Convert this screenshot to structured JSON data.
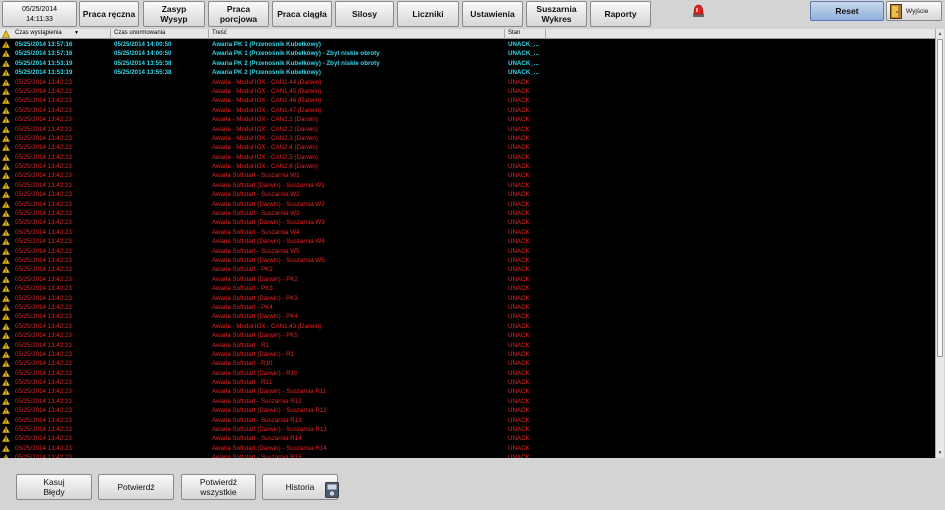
{
  "header": {
    "date": "05/25/2014",
    "time": "14:11:33",
    "nav": [
      {
        "label": "Praca ręczna",
        "name": "nav-praca-reczna"
      },
      {
        "label": "Zasyp\nWysyp",
        "name": "nav-zasyp-wysyp"
      },
      {
        "label": "Praca\nporcjowa",
        "name": "nav-praca-porcjowa"
      },
      {
        "label": "Praca ciągła",
        "name": "nav-praca-ciagla"
      },
      {
        "label": "Silosy",
        "name": "nav-silosy"
      },
      {
        "label": "Liczniki",
        "name": "nav-liczniki"
      },
      {
        "label": "Ustawienia",
        "name": "nav-ustawienia"
      },
      {
        "label": "Suszarnia\nWykres",
        "name": "nav-suszarnia-wykres"
      },
      {
        "label": "Raporty",
        "name": "nav-raporty"
      }
    ],
    "reset_label": "Reset",
    "exit_label": "Wyjście"
  },
  "alarms": {
    "columns": [
      "Czas wystąpienia",
      "Czas unormowania",
      "Treść",
      "Stan"
    ],
    "rows": [
      {
        "t1": "05/25/2014 13:57:16",
        "t2": "05/25/2014 14:00:50",
        "text": "Awaria PK 1 (Przenośnik Kubełkowy)",
        "state": "UNACK_...",
        "style": "cyan"
      },
      {
        "t1": "05/25/2014 13:57:16",
        "t2": "05/25/2014 14:00:50",
        "text": "Awaria PK 1 (Przenośnik Kubełkowy) - Zbyt niskie obroty",
        "state": "UNACK_...",
        "style": "cyan"
      },
      {
        "t1": "05/25/2014 13:53:19",
        "t2": "05/25/2014 13:55:38",
        "text": "Awaria PK 2 (Przenośnik Kubełkowy) - Zbyt niskie obroty",
        "state": "UNACK_...",
        "style": "cyan"
      },
      {
        "t1": "05/25/2014 13:53:19",
        "t2": "05/25/2014 13:55:38",
        "text": "Awaria PK 2 (Przenośnik Kubełkowy)",
        "state": "UNACK_...",
        "style": "cyan"
      },
      {
        "t1": "05/25/2014 13:42:23",
        "t2": "",
        "text": "Awaria - Moduł IOX - CAN1.44 (Darwin)",
        "state": "UNACK",
        "style": "red"
      },
      {
        "t1": "05/25/2014 13:42:23",
        "t2": "",
        "text": "Awaria - Moduł IOX - CAN1.45 (Darwin)",
        "state": "UNACK",
        "style": "red"
      },
      {
        "t1": "05/25/2014 13:42:23",
        "t2": "",
        "text": "Awaria - Moduł IOX - CAN1.46 (Darwin)",
        "state": "UNACK",
        "style": "red"
      },
      {
        "t1": "05/25/2014 13:42:23",
        "t2": "",
        "text": "Awaria - Moduł IOX - CAN1.47 (Darwin)",
        "state": "UNACK",
        "style": "red"
      },
      {
        "t1": "05/25/2014 13:42:23",
        "t2": "",
        "text": "Awaria - Moduł IOX - CAN2.1 (Darwin)",
        "state": "UNACK",
        "style": "red"
      },
      {
        "t1": "05/25/2014 13:42:23",
        "t2": "",
        "text": "Awaria - Moduł IOX - CAN2.2 (Darwin)",
        "state": "UNACK",
        "style": "red"
      },
      {
        "t1": "05/25/2014 13:42:23",
        "t2": "",
        "text": "Awaria - Moduł IOX - CAN2.3 (Darwin)",
        "state": "UNACK",
        "style": "red"
      },
      {
        "t1": "05/25/2014 13:42:23",
        "t2": "",
        "text": "Awaria - Moduł IOX - CAN2.4 (Darwin)",
        "state": "UNACK",
        "style": "red"
      },
      {
        "t1": "05/25/2014 13:42:23",
        "t2": "",
        "text": "Awaria - Moduł IOX - CAN2.5 (Darwin)",
        "state": "UNACK",
        "style": "red"
      },
      {
        "t1": "05/25/2014 13:42:23",
        "t2": "",
        "text": "Awaria - Moduł IOX - CAN2.6 (Darwin)",
        "state": "UNACK",
        "style": "red"
      },
      {
        "t1": "05/25/2014 13:42:23",
        "t2": "",
        "text": "Awaria Softstart - Suszarnia W1",
        "state": "UNACK",
        "style": "red"
      },
      {
        "t1": "05/25/2014 13:42:23",
        "t2": "",
        "text": "Awaria Softstart (Darwin) - Suszarnia W1",
        "state": "UNACK",
        "style": "red"
      },
      {
        "t1": "05/25/2014 13:42:23",
        "t2": "",
        "text": "Awaria Softstart - Suszarnia W2",
        "state": "UNACK",
        "style": "red"
      },
      {
        "t1": "05/25/2014 13:42:23",
        "t2": "",
        "text": "Awaria Softstart (Darwin) - Suszarnia W2",
        "state": "UNACK",
        "style": "red"
      },
      {
        "t1": "05/25/2014 13:42:23",
        "t2": "",
        "text": "Awaria Softstart - Suszarnia W3",
        "state": "UNACK",
        "style": "red"
      },
      {
        "t1": "05/25/2014 13:42:23",
        "t2": "",
        "text": "Awaria Softstart (Darwin) - Suszarnia W3",
        "state": "UNACK",
        "style": "red"
      },
      {
        "t1": "05/25/2014 13:42:23",
        "t2": "",
        "text": "Awaria Softstart - Suszarnia W4",
        "state": "UNACK",
        "style": "red"
      },
      {
        "t1": "05/25/2014 13:42:23",
        "t2": "",
        "text": "Awaria Softstart (Darwin) - Suszarnia W4",
        "state": "UNACK",
        "style": "red"
      },
      {
        "t1": "05/25/2014 13:42:23",
        "t2": "",
        "text": "Awaria Softstart - Suszarnia W5",
        "state": "UNACK",
        "style": "red"
      },
      {
        "t1": "05/25/2014 13:42:23",
        "t2": "",
        "text": "Awaria Softstart (Darwin) - Suszarnia W5",
        "state": "UNACK",
        "style": "red"
      },
      {
        "t1": "05/25/2014 13:42:23",
        "t2": "",
        "text": "Awaria Softstart - PK2",
        "state": "UNACK",
        "style": "red"
      },
      {
        "t1": "05/25/2014 13:42:23",
        "t2": "",
        "text": "Awaria Softstart (Darwin) - PK2",
        "state": "UNACK",
        "style": "red"
      },
      {
        "t1": "05/25/2014 13:42:23",
        "t2": "",
        "text": "Awaria Softstart - PK3",
        "state": "UNACK",
        "style": "red"
      },
      {
        "t1": "05/25/2014 13:42:23",
        "t2": "",
        "text": "Awaria Softstart (Darwin) - PK3",
        "state": "UNACK",
        "style": "red"
      },
      {
        "t1": "05/25/2014 13:42:23",
        "t2": "",
        "text": "Awaria Softstart - PK4",
        "state": "UNACK",
        "style": "red"
      },
      {
        "t1": "05/25/2014 13:42:23",
        "t2": "",
        "text": "Awaria Softstart (Darwin) - PK4",
        "state": "UNACK",
        "style": "red"
      },
      {
        "t1": "05/25/2014 13:42:23",
        "t2": "",
        "text": "Awaria - Moduł IOX - CAN1.43 (Darwin)",
        "state": "UNACK",
        "style": "red"
      },
      {
        "t1": "05/25/2014 13:42:23",
        "t2": "",
        "text": "Awaria Softstart (Darwin) - PK5",
        "state": "UNACK",
        "style": "red"
      },
      {
        "t1": "05/25/2014 13:42:23",
        "t2": "",
        "text": "Awaria Softstart - R1",
        "state": "UNACK",
        "style": "red"
      },
      {
        "t1": "05/25/2014 13:42:23",
        "t2": "",
        "text": "Awaria Softstart (Darwin) - R1",
        "state": "UNACK",
        "style": "red"
      },
      {
        "t1": "05/25/2014 13:42:23",
        "t2": "",
        "text": "Awaria Softstart - R10",
        "state": "UNACK",
        "style": "red"
      },
      {
        "t1": "05/25/2014 13:42:23",
        "t2": "",
        "text": "Awaria Softstart (Darwin) - R10",
        "state": "UNACK",
        "style": "red"
      },
      {
        "t1": "05/25/2014 13:42:23",
        "t2": "",
        "text": "Awaria Softstart - R11",
        "state": "UNACK",
        "style": "red"
      },
      {
        "t1": "05/25/2014 13:42:23",
        "t2": "",
        "text": "Awaria Softstart (Darwin) - Suszarnia R11",
        "state": "UNACK",
        "style": "red"
      },
      {
        "t1": "05/25/2014 13:42:23",
        "t2": "",
        "text": "Awaria Softstart - Suszarnia R12",
        "state": "UNACK",
        "style": "red"
      },
      {
        "t1": "05/25/2014 13:42:23",
        "t2": "",
        "text": "Awaria Softstart (Darwin) - Suszarnia R12",
        "state": "UNACK",
        "style": "red"
      },
      {
        "t1": "05/25/2014 13:42:23",
        "t2": "",
        "text": "Awaria Softstart - Suszarnia R13",
        "state": "UNACK",
        "style": "red"
      },
      {
        "t1": "05/25/2014 13:42:23",
        "t2": "",
        "text": "Awaria Softstart (Darwin) - Suszarnia R13",
        "state": "UNACK",
        "style": "red"
      },
      {
        "t1": "05/25/2014 13:42:23",
        "t2": "",
        "text": "Awaria Softstart - Suszarnia R14",
        "state": "UNACK",
        "style": "red"
      },
      {
        "t1": "05/25/2014 13:42:23",
        "t2": "",
        "text": "Awaria Softstart (Darwin) - Suszarnia R14",
        "state": "UNACK",
        "style": "red"
      },
      {
        "t1": "05/25/2014 13:42:23",
        "t2": "",
        "text": "Awaria Softstart - Suszarnia R15",
        "state": "UNACK",
        "style": "red"
      }
    ]
  },
  "footer": {
    "buttons": [
      {
        "label": "Kasuj\nBłędy",
        "name": "kasuj-bledy-button"
      },
      {
        "label": "Potwierdź",
        "name": "potwierdz-button"
      },
      {
        "label": "Potwierdź\nwszystkie",
        "name": "potwierdz-wszystkie-button"
      },
      {
        "label": "Historia",
        "name": "historia-button"
      }
    ]
  },
  "colors": {
    "cyan": "#35d4e8",
    "red": "#ee2222",
    "reset": "#8fb0dc"
  },
  "icons": [
    "warning-icon",
    "siren-icon",
    "exit-door-icon",
    "history-icon",
    "sort-arrow-icon"
  ]
}
